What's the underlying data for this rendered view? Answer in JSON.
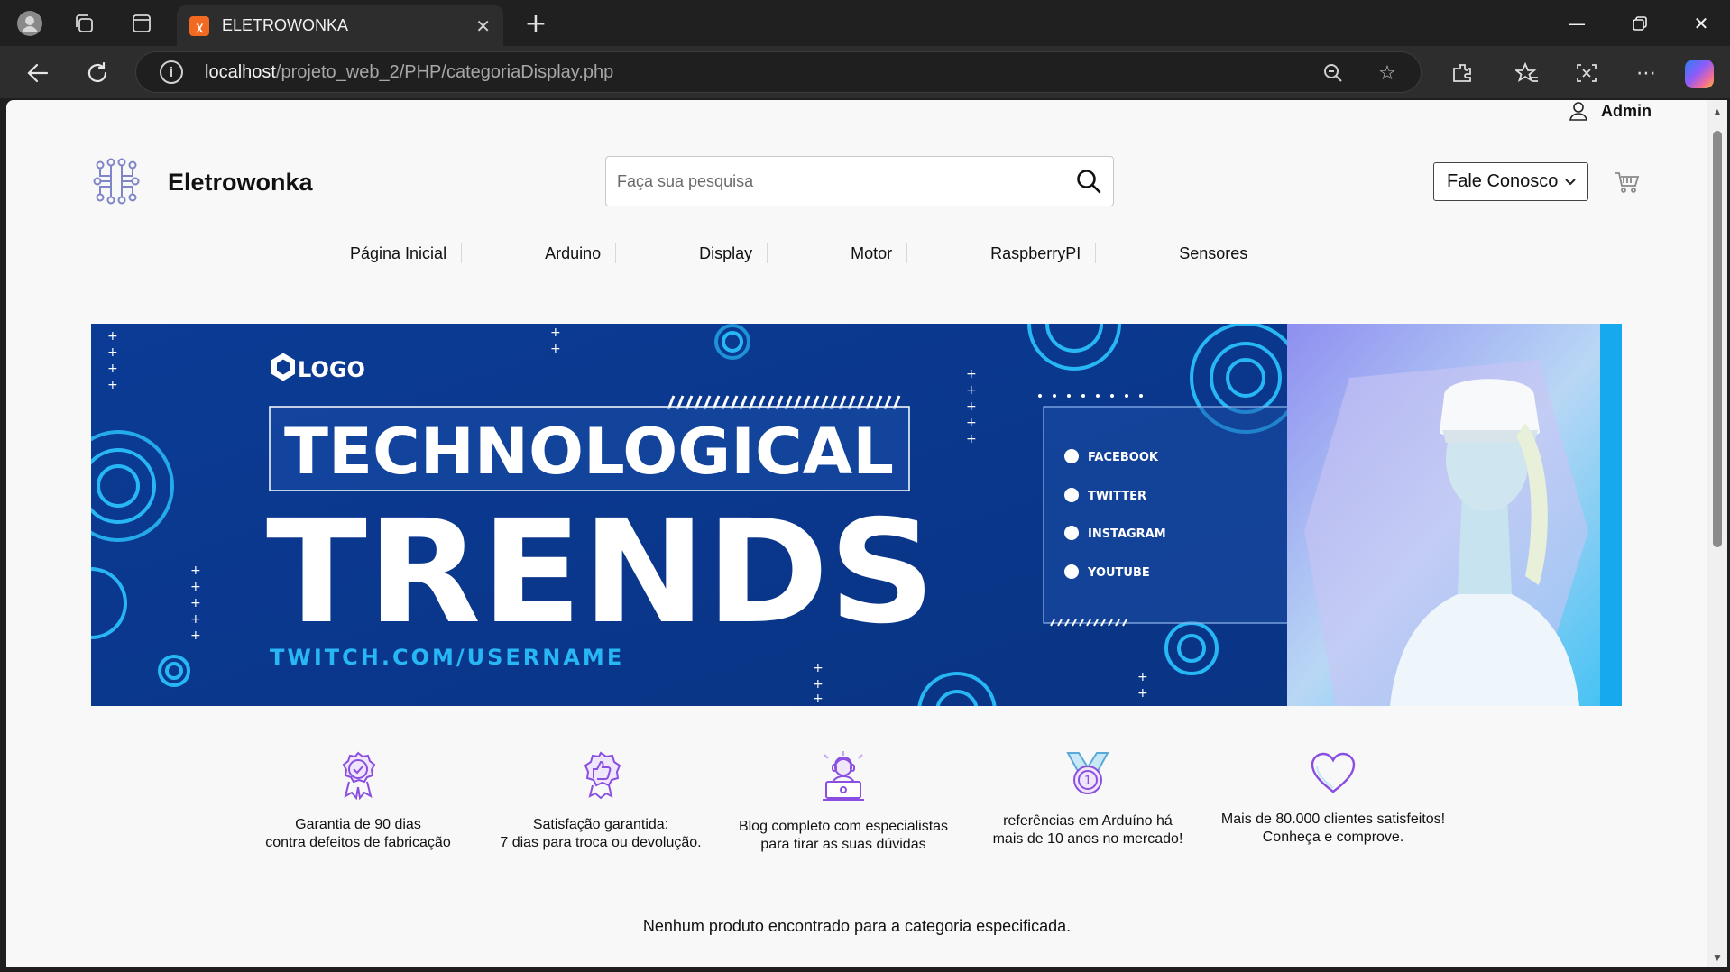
{
  "browser": {
    "tab_title": "ELETROWONKA",
    "tab_favicon": "xampp-favicon",
    "url_host": "localhost",
    "url_path": "/projeto_web_2/PHP/categoriaDisplay.php"
  },
  "header": {
    "admin_label": "Admin",
    "brand": "Eletrowonka",
    "search_placeholder": "Faça sua pesquisa",
    "contact_select": "Fale Conosco"
  },
  "menu": [
    "Página Inicial",
    "Arduino",
    "Display",
    "Motor",
    "RaspberryPI",
    "Sensores"
  ],
  "banner": {
    "logo_text": "LOGO",
    "line1": "TECHNOLOGICAL",
    "line2": "TRENDS",
    "handle": "TWITCH.COM/USERNAME",
    "socials": [
      "FACEBOOK",
      "TWITTER",
      "INSTAGRAM",
      "YOUTUBE"
    ]
  },
  "features": [
    {
      "icon": "certificate-ribbon-icon",
      "text": "Garantia de 90 dias\ncontra defeitos de fabricação"
    },
    {
      "icon": "thumbs-up-badge-icon",
      "text": "Satisfação garantida:\n7 dias para troca ou devolução."
    },
    {
      "icon": "expert-laptop-icon",
      "text": "Blog completo com especialistas\npara tirar as suas dúvidas"
    },
    {
      "icon": "medal-icon",
      "text": "referências em Arduíno há\nmais de 10 anos no mercado!"
    },
    {
      "icon": "heart-icon",
      "text": "Mais de 80.000 clientes satisfeitos!\nConheça e comprove."
    }
  ],
  "empty_message": "Nenhum produto encontrado para a categoria especificada.",
  "colors": {
    "banner_blue": "#0c3a8f",
    "banner_accent": "#27b7f5",
    "icon_purple": "#8a4fe0"
  }
}
